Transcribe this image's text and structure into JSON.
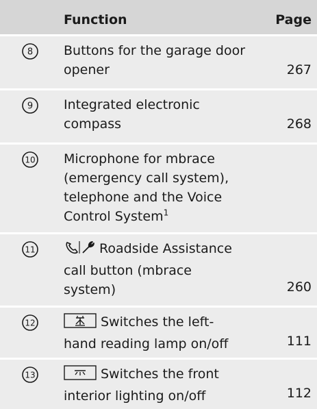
{
  "header": {
    "function_label": "Function",
    "page_label": "Page"
  },
  "rows": [
    {
      "number": "8",
      "lines": [
        "Buttons for the garage door",
        "opener"
      ],
      "page": "267"
    },
    {
      "number": "9",
      "lines": [
        "Integrated electronic",
        "compass"
      ],
      "page": "268"
    },
    {
      "number": "10",
      "lines": [
        "Microphone for mbrace",
        "(emergency call system),",
        "telephone and the Voice",
        "Control System"
      ],
      "superscript": "1",
      "page": ""
    },
    {
      "number": "11",
      "lines": [
        "Roadside Assistance",
        "call button (mbrace",
        "system)"
      ],
      "page": "260",
      "icon": "phone-wrench-icon"
    },
    {
      "number": "12",
      "lines": [
        "Switches the left-",
        "hand reading lamp on/off"
      ],
      "page": "111",
      "icon": "reading-lamp-icon"
    },
    {
      "number": "13",
      "lines": [
        "Switches the front",
        "interior lighting on/off"
      ],
      "page": "112",
      "icon": "interior-light-icon"
    }
  ]
}
